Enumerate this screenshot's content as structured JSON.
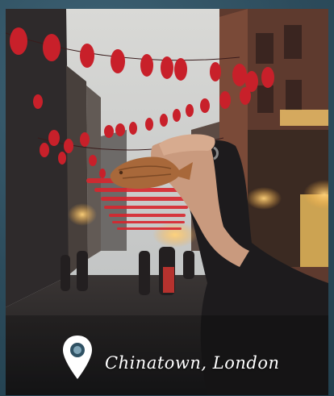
{
  "caption": {
    "icon": "location-pin-icon",
    "text": "Chinatown, London"
  },
  "colors": {
    "background": "#2f5163",
    "lantern": "#c8202a",
    "caption_text": "#ffffff"
  }
}
